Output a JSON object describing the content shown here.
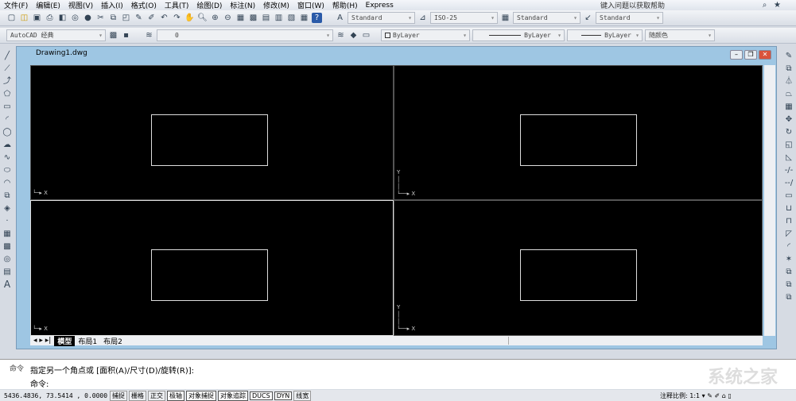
{
  "menu": [
    "文件(F)",
    "编辑(E)",
    "视图(V)",
    "插入(I)",
    "格式(O)",
    "工具(T)",
    "绘图(D)",
    "标注(N)",
    "修改(M)",
    "窗口(W)",
    "帮助(H)",
    "Express"
  ],
  "help_placeholder": "键入问题以获取帮助",
  "toolbar2": {
    "text_style": "Standard",
    "dim_style": "ISO-25",
    "table_style": "Standard",
    "multileader_style": "Standard"
  },
  "toolbar3": {
    "workspace": "AutoCAD 经典",
    "layer": "0",
    "color": "ByLayer",
    "linetype": "ByLayer",
    "lineweight": "ByLayer",
    "plot_style": "随颜色"
  },
  "drawing": {
    "title": "Drawing1.dwg"
  },
  "tabs": [
    "模型",
    "布局1",
    "布局2"
  ],
  "command": {
    "side_label": "命令",
    "line1": "指定另一个角点或 [面积(A)/尺寸(D)/旋转(R)]:",
    "line2": "命令:"
  },
  "status": {
    "coords": "5436.4836, 73.5414 , 0.0000",
    "toggles": [
      {
        "label": "捕捉",
        "on": false
      },
      {
        "label": "栅格",
        "on": false
      },
      {
        "label": "正交",
        "on": false
      },
      {
        "label": "极轴",
        "on": true
      },
      {
        "label": "对象捕捉",
        "on": true
      },
      {
        "label": "对象追踪",
        "on": true
      },
      {
        "label": "DUCS",
        "on": true
      },
      {
        "label": "DYN",
        "on": true
      },
      {
        "label": "线宽",
        "on": false
      }
    ],
    "annotation_scale_label": "注释比例:",
    "annotation_scale": "1:1"
  },
  "watermark": "系统之家"
}
